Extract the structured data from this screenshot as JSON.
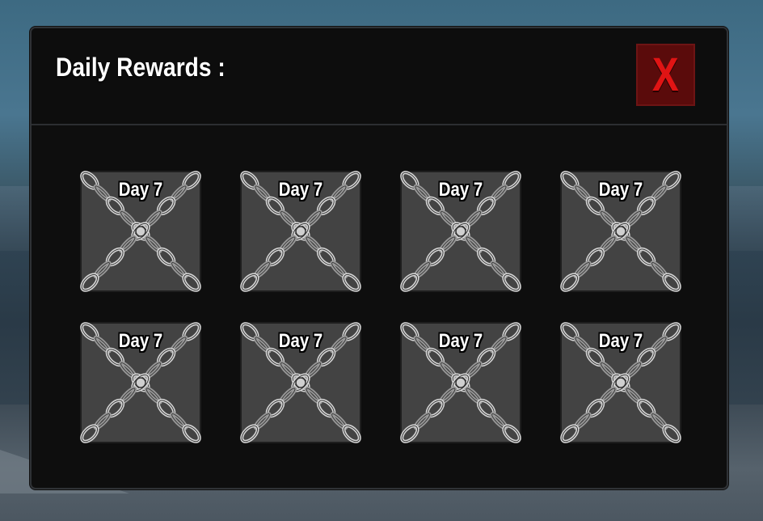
{
  "window": {
    "title": "Daily Rewards :",
    "close_label": "X",
    "close_icon": "close-x-icon"
  },
  "colors": {
    "panel_bg": "#0e0e0e",
    "tile_bg": "#434343",
    "close_bg": "#5a0b0b",
    "close_fg": "#e01414"
  },
  "rewards": [
    {
      "label": "Day 7",
      "locked": true,
      "icon": "chain-lock-icon"
    },
    {
      "label": "Day 7",
      "locked": true,
      "icon": "chain-lock-icon"
    },
    {
      "label": "Day 7",
      "locked": true,
      "icon": "chain-lock-icon"
    },
    {
      "label": "Day 7",
      "locked": true,
      "icon": "chain-lock-icon"
    },
    {
      "label": "Day 7",
      "locked": true,
      "icon": "chain-lock-icon"
    },
    {
      "label": "Day 7",
      "locked": true,
      "icon": "chain-lock-icon"
    },
    {
      "label": "Day 7",
      "locked": true,
      "icon": "chain-lock-icon"
    },
    {
      "label": "Day 7",
      "locked": true,
      "icon": "chain-lock-icon"
    }
  ]
}
